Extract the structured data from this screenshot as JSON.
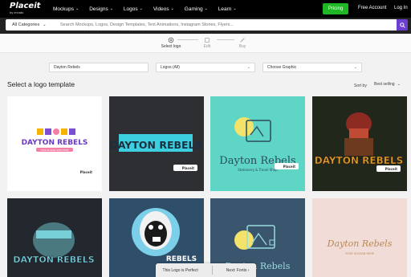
{
  "nav": {
    "brand": "Placeit",
    "brand_sub": "by envato",
    "menu": [
      {
        "label": "Mockups"
      },
      {
        "label": "Designs"
      },
      {
        "label": "Logos"
      },
      {
        "label": "Videos"
      },
      {
        "label": "Gaming"
      },
      {
        "label": "Learn"
      }
    ],
    "pricing": "Pricing",
    "free_account": "Free Account",
    "login": "Log In"
  },
  "search": {
    "category": "All Categories",
    "placeholder": "Search Mockups, Logos, Design Templates, Text Animations, Instagram Stories, Flyers..."
  },
  "steps": [
    {
      "label": "Select logo"
    },
    {
      "label": "Edit"
    },
    {
      "label": "Buy"
    }
  ],
  "filters": {
    "name": "Dayton Rebels",
    "logos": "Logos (All)",
    "graphic": "Choose Graphic"
  },
  "section_title": "Select a logo template",
  "sort": {
    "label": "Sort by",
    "value": "Best selling"
  },
  "cards": [
    {
      "title": "DAYTON REBELS",
      "subtitle": "YOUR SLOGAN GOES HERE",
      "badge": "Placeit"
    },
    {
      "title": "DAYTON REBELS",
      "badge": "Placeit"
    },
    {
      "title": "Dayton Rebels",
      "subtitle": "Stationery & Travel Shop",
      "badge": "Placeit"
    },
    {
      "title": "DAYTON REBELS",
      "badge": "Placeit"
    },
    {
      "title": "DAYTON REBELS"
    },
    {
      "title": "REBELS"
    },
    {
      "title": "Dayton Rebels"
    },
    {
      "title": "Dayton Rebels",
      "subtitle": "YOUR SLOGAN HERE"
    }
  ],
  "bottom": {
    "left": "This Logo is Perfect",
    "right": "Next: Fonts"
  },
  "colors": {
    "pricing": "#1fb723",
    "search_button": "#6d3fd1",
    "nav": "#000000"
  }
}
